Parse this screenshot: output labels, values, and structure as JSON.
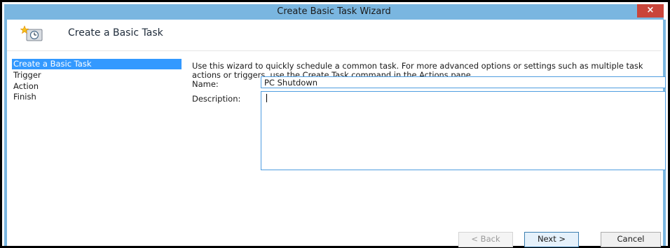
{
  "window": {
    "title": "Create Basic Task Wizard",
    "close_glyph": "×"
  },
  "header": {
    "title": "Create a Basic Task",
    "icon": "task-scheduler-icon"
  },
  "nav": {
    "items": [
      {
        "label": "Create a Basic Task",
        "selected": true
      },
      {
        "label": "Trigger",
        "selected": false
      },
      {
        "label": "Action",
        "selected": false
      },
      {
        "label": "Finish",
        "selected": false
      }
    ]
  },
  "main": {
    "intro": "Use this wizard to quickly schedule a common task.  For more advanced options or settings such as multiple task actions or triggers, use the Create Task command in the Actions pane.",
    "name_label": "Name:",
    "name_value": "PC Shutdown",
    "description_label": "Description:",
    "description_value": ""
  },
  "buttons": {
    "back": "< Back",
    "next": "Next >",
    "cancel": "Cancel"
  },
  "colors": {
    "titlebar": "#7ab6e0",
    "close": "#c9453a",
    "selection": "#3399ff",
    "input_border": "#4f9de0"
  }
}
